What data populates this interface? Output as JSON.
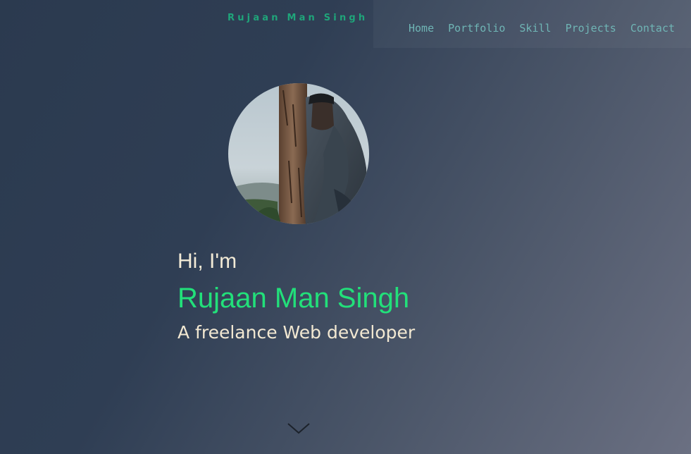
{
  "header": {
    "brand": "Rujaan Man Singh",
    "nav": [
      {
        "label": "Home"
      },
      {
        "label": "Portfolio"
      },
      {
        "label": "Skill"
      },
      {
        "label": "Projects"
      },
      {
        "label": "Contact"
      }
    ]
  },
  "hero": {
    "greeting": "Hi, I'm",
    "name": "Rujaan Man Singh",
    "tagline": "A freelance Web developer",
    "avatar_icon": "profile-photo",
    "scroll_icon": "chevron-down-icon"
  },
  "colors": {
    "accent": "#22e07a",
    "brand": "#1fa57a",
    "nav": "#6fb5b5",
    "text": "#f2ead6",
    "background_start": "#2b3a4f",
    "background_end": "#6b7082"
  }
}
